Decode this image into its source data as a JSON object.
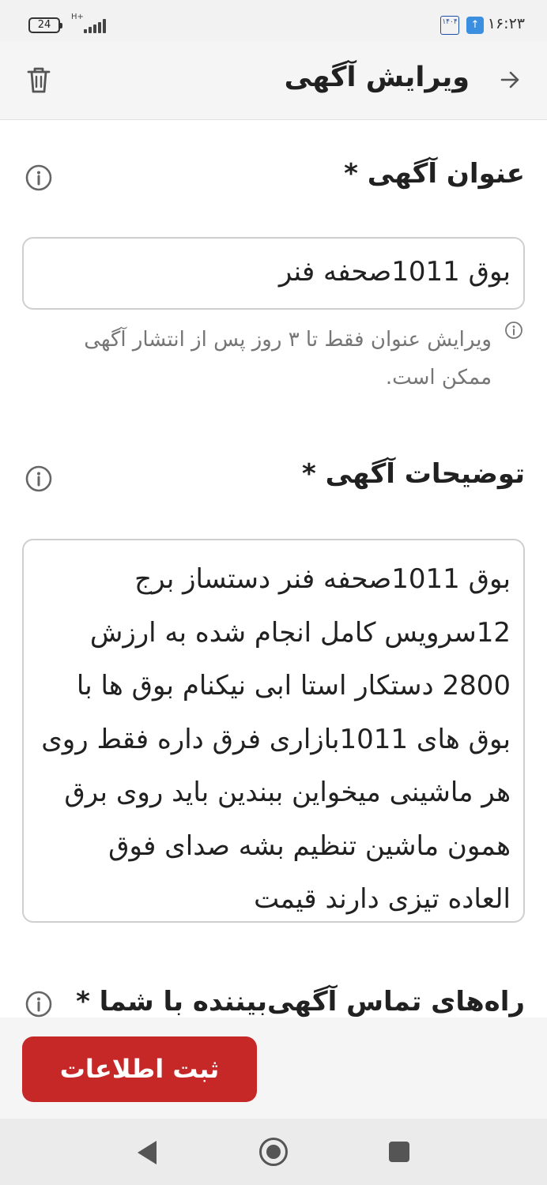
{
  "status_bar": {
    "battery": "24",
    "network": "H+",
    "time": "۱۶:۲۳",
    "calendar_badge": "۱۴۰۴"
  },
  "app_bar": {
    "title": "ویرایش آگهی"
  },
  "form": {
    "title_label": "عنوان آگهی *",
    "title_value": "بوق 1011صحفه فنر",
    "title_hint": "ویرایش عنوان فقط تا ۳ روز پس از انتشار آگهی ممکن است.",
    "description_label": "توضیحات آگهی *",
    "description_value": "بوق 1011صحفه فنر دستساز برج 12سرویس کامل انجام شده به ارزش 2800 دستکار استا ابی نیکنام بوق ها با بوق های 1011بازاری فرق داره فقط روی هر ماشینی میخواین ببندین باید روی برق همون ماشین تنظیم بشه صدای فوق العاده تیزی دارند قیمت",
    "contact_label": "راه‌های تماس آگهی‌بیننده با شما *"
  },
  "actions": {
    "submit_label": "ثبت اطلاعات"
  },
  "colors": {
    "accent": "#c62828",
    "border": "#cfcfcf",
    "hint_text": "#757575"
  },
  "icons": [
    "back-arrow-icon",
    "trash-icon",
    "info-icon",
    "nav-back-icon",
    "nav-home-icon",
    "nav-recent-icon"
  ]
}
